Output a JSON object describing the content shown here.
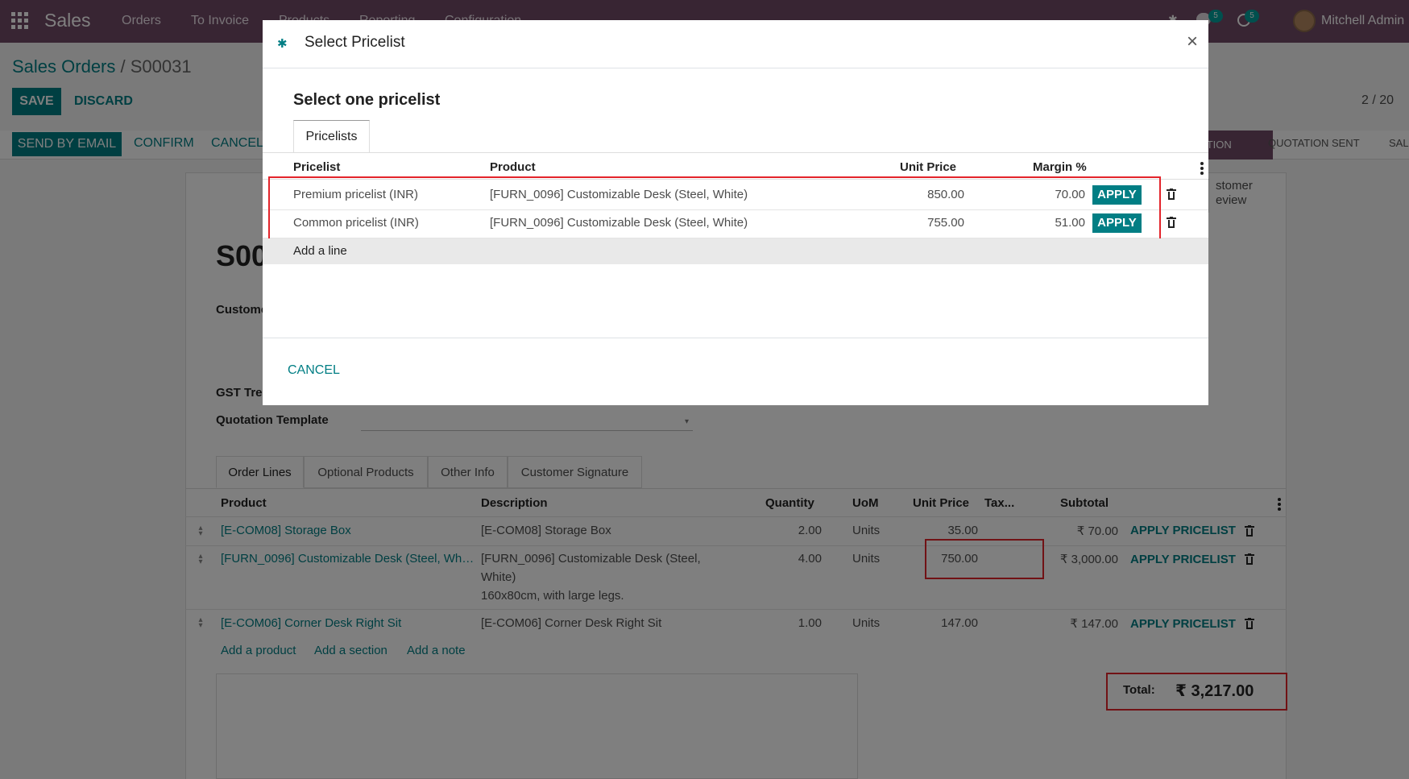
{
  "navbar": {
    "brand": "Sales",
    "menu": [
      "Orders",
      "To Invoice",
      "Products",
      "Reporting",
      "Configuration"
    ],
    "messages_count": "5",
    "activities_count": "5",
    "user": "Mitchell Admin"
  },
  "breadcrumb": {
    "parent": "Sales Orders",
    "separator": " / ",
    "current": "S00031"
  },
  "buttons": {
    "save": "SAVE",
    "discard": "DISCARD",
    "send_email": "SEND BY EMAIL",
    "confirm": "CONFIRM",
    "cancel": "CANCEL"
  },
  "pager": "2 / 20",
  "status": {
    "quotation": "ATION",
    "sent": "QUOTATION SENT",
    "sales": "SAL"
  },
  "smart_button": {
    "line1": "stomer",
    "line2": "eview"
  },
  "form": {
    "name": "S00",
    "customer_label": "Custome",
    "gst_label": "GST Trea",
    "template_label": "Quotation Template"
  },
  "tabs": [
    "Order Lines",
    "Optional Products",
    "Other Info",
    "Customer Signature"
  ],
  "order_lines": {
    "headers": {
      "product": "Product",
      "description": "Description",
      "quantity": "Quantity",
      "uom": "UoM",
      "unit_price": "Unit Price",
      "tax": "Tax...",
      "subtotal": "Subtotal"
    },
    "rows": [
      {
        "product": "[E-COM08] Storage Box",
        "desc1": "[E-COM08] Storage Box",
        "desc2": "",
        "desc3": "",
        "qty": "2.00",
        "uom": "Units",
        "price": "35.00",
        "subtotal": "₹ 70.00",
        "action": "APPLY PRICELIST"
      },
      {
        "product": "[FURN_0096] Customizable Desk (Steel, Wh…",
        "desc1": "[FURN_0096] Customizable Desk (Steel,",
        "desc2": "White)",
        "desc3": "160x80cm, with large legs.",
        "qty": "4.00",
        "uom": "Units",
        "price": "750.00",
        "subtotal": "₹ 3,000.00",
        "action": "APPLY PRICELIST"
      },
      {
        "product": "[E-COM06] Corner Desk Right Sit",
        "desc1": "[E-COM06] Corner Desk Right Sit",
        "desc2": "",
        "desc3": "",
        "qty": "1.00",
        "uom": "Units",
        "price": "147.00",
        "subtotal": "₹ 147.00",
        "action": "APPLY PRICELIST"
      }
    ],
    "add_product": "Add a product",
    "add_section": "Add a section",
    "add_note": "Add a note"
  },
  "total": {
    "label": "Total:",
    "value": "₹ 3,217.00"
  },
  "modal": {
    "title": "Select Pricelist",
    "subtitle": "Select one pricelist",
    "tab": "Pricelists",
    "headers": {
      "pricelist": "Pricelist",
      "product": "Product",
      "unit_price": "Unit Price",
      "margin": "Margin %"
    },
    "rows": [
      {
        "pricelist": "Premium pricelist (INR)",
        "product": "[FURN_0096] Customizable Desk (Steel, White)",
        "price": "850.00",
        "margin": "70.00",
        "apply": "APPLY"
      },
      {
        "pricelist": "Common pricelist (INR)",
        "product": "[FURN_0096] Customizable Desk (Steel, White)",
        "price": "755.00",
        "margin": "51.00",
        "apply": "APPLY"
      }
    ],
    "add_line": "Add a line",
    "cancel": "CANCEL",
    "close": "×"
  }
}
